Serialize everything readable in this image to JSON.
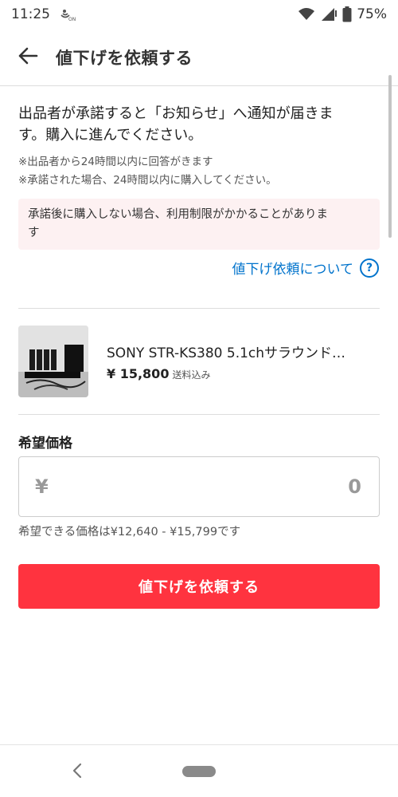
{
  "status_bar": {
    "time": "11:25",
    "battery": "75%"
  },
  "header": {
    "title": "値下げを依頼する"
  },
  "notice": {
    "line1": "出品者が承諾すると「お知らせ」へ通知が届きま",
    "line2": "す。購入に進んでください。",
    "sub1": "※出品者から24時間以内に回答がきます",
    "sub2": "※承諾された場合、24時間以内に購入してください。",
    "warning_line1": "承諾後に購入しない場合、利用制限がかかることがありま",
    "warning_line2": "す",
    "link": "値下げ依頼について"
  },
  "item": {
    "name": "SONY STR-KS380 5.1chサラウンド…",
    "price": "¥ 15,800",
    "shipping": "送料込み"
  },
  "price_input": {
    "label": "希望価格",
    "currency": "¥",
    "value": "0",
    "range": "希望できる価格は¥12,640 - ¥15,799です"
  },
  "submit": {
    "label": "値下げを依頼する"
  },
  "colors": {
    "accent": "#ff333f",
    "link": "#0073cc",
    "warning_bg": "#fdf1f2"
  },
  "icons": {
    "status": [
      "wifi-icon",
      "signal-icon",
      "battery-icon",
      "nfc-icon"
    ],
    "header": "arrow-left-icon",
    "help": "question-circle-icon"
  }
}
